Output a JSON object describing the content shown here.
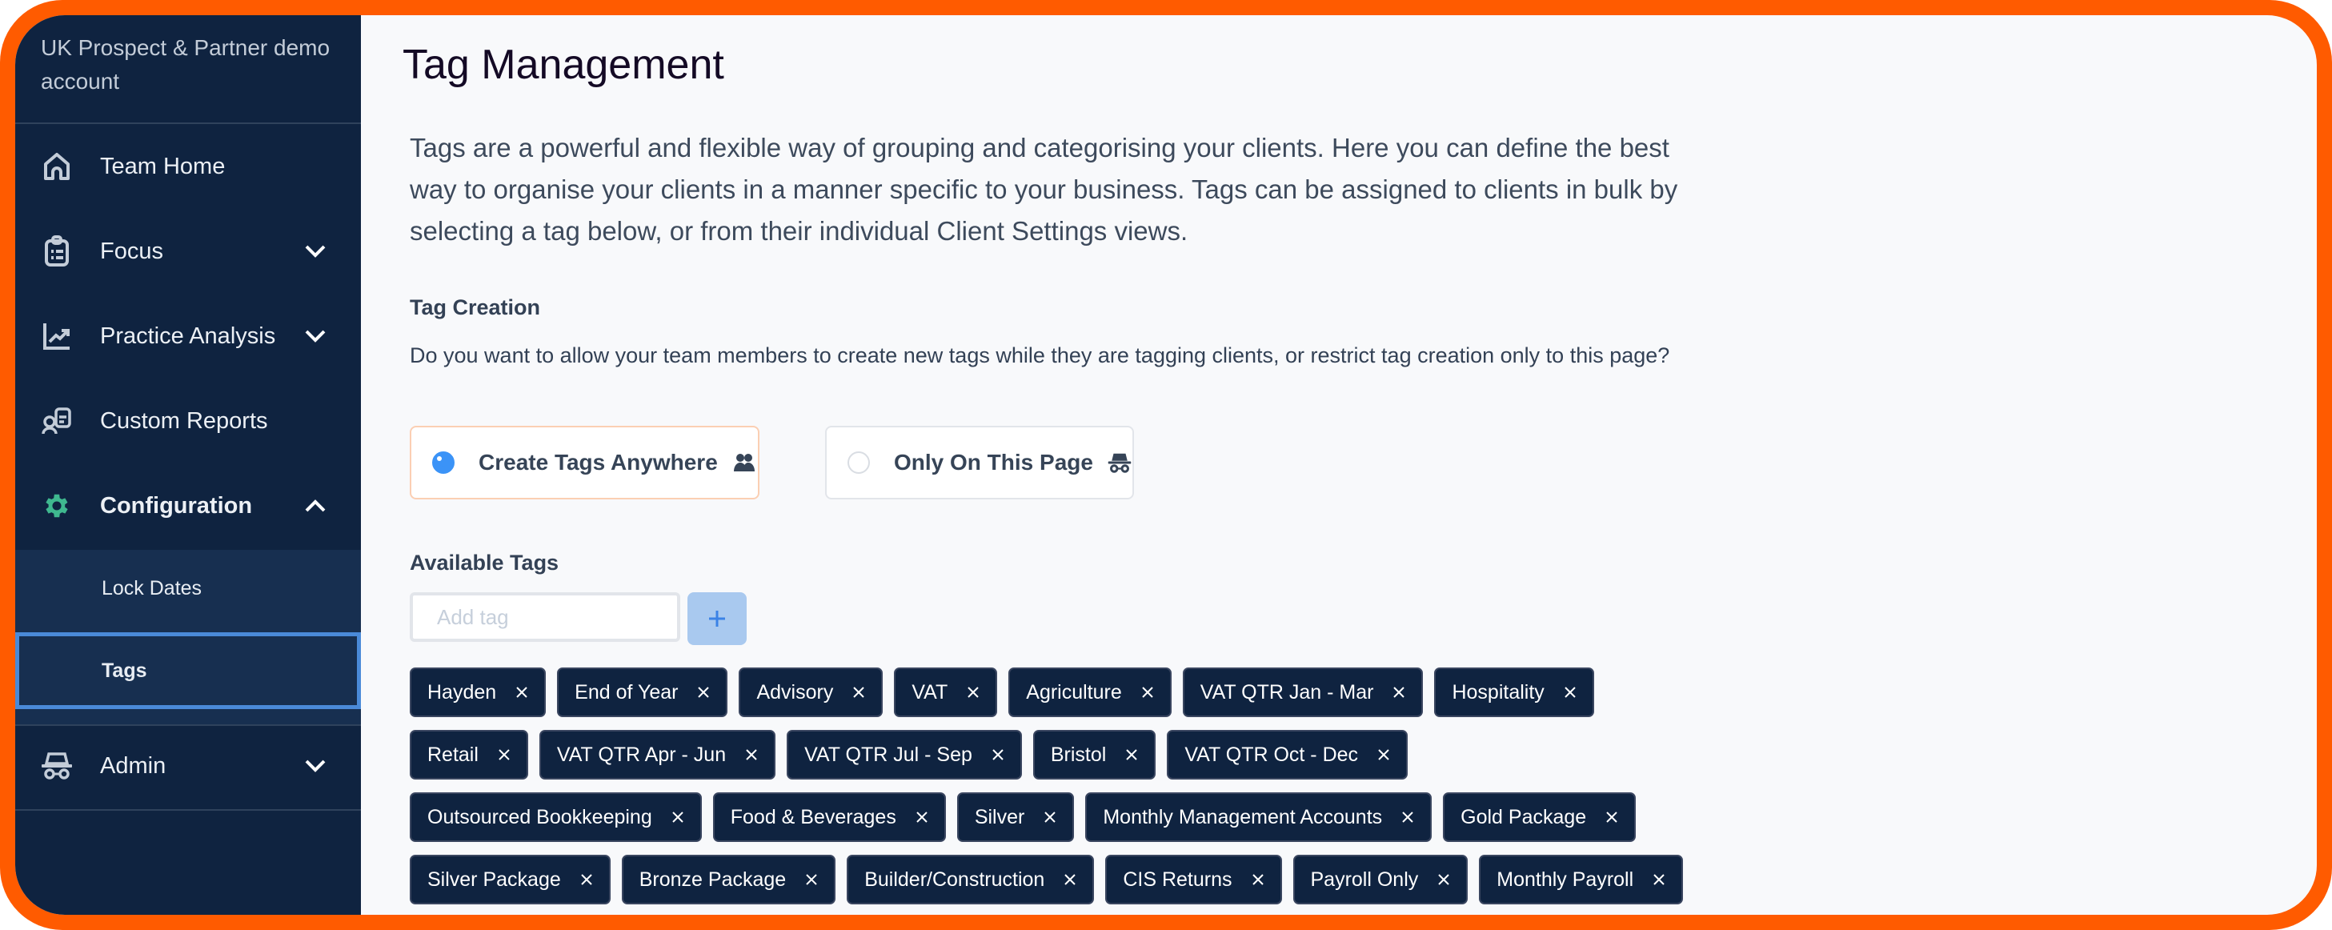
{
  "sidebar": {
    "org_name": "UK Prospect & Partner demo account",
    "items": [
      {
        "label": "Team Home",
        "icon": "home-icon",
        "chevron": null
      },
      {
        "label": "Focus",
        "icon": "clipboard-list-icon",
        "chevron": "down"
      },
      {
        "label": "Practice Analysis",
        "icon": "chart-line-icon",
        "chevron": "down"
      },
      {
        "label": "Custom Reports",
        "icon": "user-report-icon",
        "chevron": null
      },
      {
        "label": "Configuration",
        "icon": "gear-icon",
        "chevron": "up",
        "active": true
      },
      {
        "label": "Admin",
        "icon": "incognito-icon",
        "chevron": "down"
      }
    ],
    "submenu": [
      {
        "label": "Lock Dates",
        "selected": false
      },
      {
        "label": "Tags",
        "selected": true
      }
    ]
  },
  "main": {
    "title": "Tag Management",
    "description": "Tags are a powerful and flexible way of grouping and categorising your clients. Here you can define the best way to organise your clients in a manner specific to your business. Tags can be assigned to clients in bulk by selecting a tag below, or from their individual Client Settings views.",
    "tag_creation": {
      "heading": "Tag Creation",
      "question": "Do you want to allow your team members to create new tags while they are tagging clients, or restrict tag creation only to this page?",
      "options": [
        {
          "label": "Create Tags Anywhere",
          "icon": "users-icon",
          "checked": true
        },
        {
          "label": "Only On This Page",
          "icon": "incognito-icon",
          "checked": false
        }
      ]
    },
    "available_tags": {
      "heading": "Available Tags",
      "input_placeholder": "Add tag",
      "input_value": "",
      "add_button_label": "+",
      "rows": [
        [
          "Hayden",
          "End of Year",
          "Advisory",
          "VAT",
          "Agriculture",
          "VAT QTR Jan - Mar",
          "Hospitality"
        ],
        [
          "Retail",
          "VAT QTR Apr - Jun",
          "VAT QTR Jul - Sep",
          "Bristol",
          "VAT QTR Oct - Dec"
        ],
        [
          "Outsourced Bookkeeping",
          "Food & Beverages",
          "Silver",
          "Monthly Management Accounts",
          "Gold Package"
        ],
        [
          "Silver Package",
          "Bronze Package",
          "Builder/Construction",
          "CIS Returns",
          "Payroll Only",
          "Monthly Payroll"
        ]
      ]
    }
  },
  "colors": {
    "frame": "#ff5b00",
    "sidebar_bg": "#0f2340",
    "submenu_bg": "#172f50",
    "selected_outline": "#4a8ad8",
    "config_icon": "#3fb88f",
    "tag_bg": "#0f2340",
    "radio_checked": "#3b93f7",
    "add_button_bg": "#a9c9ef"
  }
}
